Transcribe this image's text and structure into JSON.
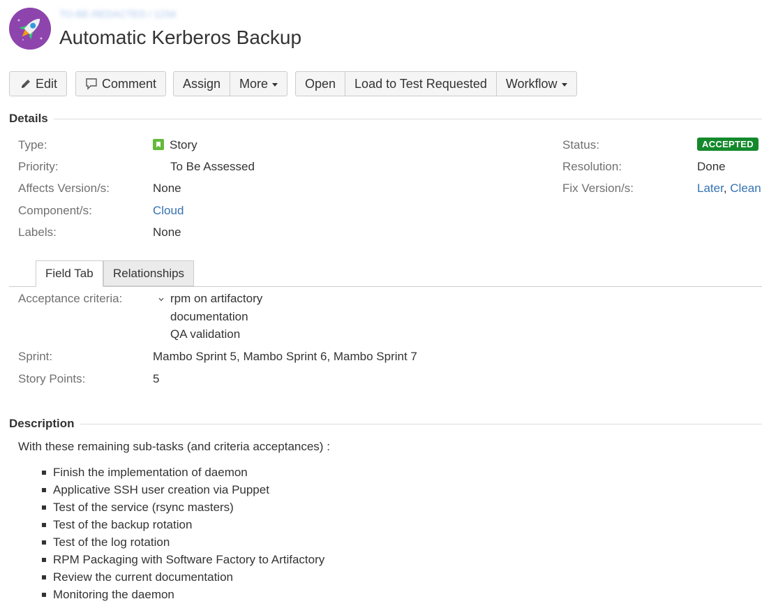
{
  "header": {
    "breadcrumb": "TO-BE-REDACTED / 1234",
    "title": "Automatic Kerberos Backup"
  },
  "toolbar": {
    "edit": "Edit",
    "comment": "Comment",
    "assign": "Assign",
    "more": "More",
    "open": "Open",
    "load_to_test": "Load to Test Requested",
    "workflow": "Workflow"
  },
  "details": {
    "heading": "Details",
    "type_label": "Type:",
    "type_value": "Story",
    "priority_label": "Priority:",
    "priority_value": "To Be Assessed",
    "affects_label": "Affects Version/s:",
    "affects_value": "None",
    "component_label": "Component/s:",
    "component_value": "Cloud",
    "labels_label": "Labels:",
    "labels_value": "None",
    "status_label": "Status:",
    "status_value": "ACCEPTED",
    "resolution_label": "Resolution:",
    "resolution_value": "Done",
    "fix_label": "Fix Version/s:",
    "fix_value_1": "Later",
    "fix_sep": ",",
    "fix_value_2": "Clean"
  },
  "tabs": {
    "field_tab": "Field Tab",
    "relationships": "Relationships"
  },
  "fields": {
    "acceptance_label": "Acceptance criteria:",
    "acceptance_items": [
      "rpm on artifactory",
      "documentation",
      "QA validation"
    ],
    "sprint_label": "Sprint:",
    "sprint_value": "Mambo Sprint 5, Mambo Sprint 6, Mambo Sprint 7",
    "points_label": "Story Points:",
    "points_value": "5"
  },
  "description": {
    "heading": "Description",
    "intro": "With these remaining sub-tasks (and criteria acceptances) :",
    "items": [
      "Finish the implementation of daemon",
      "Applicative SSH user creation via Puppet",
      "Test of the service (rsync masters)",
      "Test of the backup rotation",
      "Test of the log rotation",
      "RPM Packaging with Software Factory to Artifactory",
      "Review the current documentation",
      "Monitoring the daemon"
    ]
  },
  "colors": {
    "accepted_badge": "#14892c",
    "link": "#3572b0",
    "avatar_bg": "#8e44ad",
    "story_icon": "#63ba3c"
  },
  "icons": {
    "avatar": "rocket-icon",
    "edit": "pencil-icon",
    "comment": "speech-bubble-icon",
    "type": "story-bookmark-icon",
    "acceptance_toggle": "chevron-down-icon"
  }
}
